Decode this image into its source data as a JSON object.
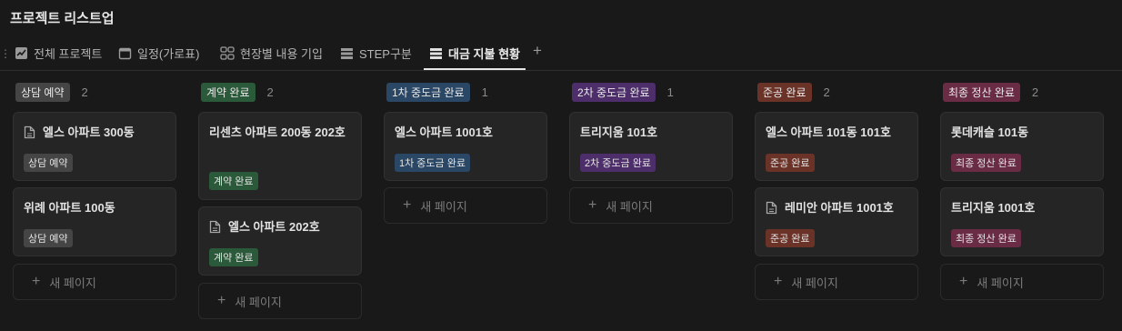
{
  "page_title": "프로젝트 리스트업",
  "tabs": [
    {
      "label": "전체 프로젝트",
      "icon": "trend-chart-icon"
    },
    {
      "label": "일정(가로표)",
      "icon": "calendar-icon"
    },
    {
      "label": "현장별 내용 기입",
      "icon": "gallery-grid-icon"
    },
    {
      "label": "STEP구분",
      "icon": "table-icon"
    },
    {
      "label": "대금 지불 현황",
      "icon": "board-icon",
      "active": true
    }
  ],
  "add_tab": "+",
  "new_page_label": "새 페이지",
  "columns": [
    {
      "label": "상담 예약",
      "count": "2",
      "color": "#454545",
      "cards": [
        {
          "title": "엘스 아파트 300동",
          "has_doc_icon": true,
          "badge": "상담 예약"
        },
        {
          "title": "위례 아파트 100동",
          "has_doc_icon": false,
          "badge": "상담 예약"
        }
      ]
    },
    {
      "label": "계약 완료",
      "count": "2",
      "color": "#2b5a3a",
      "cards": [
        {
          "title": "리센츠 아파트 200동 202호",
          "has_doc_icon": false,
          "badge": "계약 완료"
        },
        {
          "title": "엘스 아파트 202호",
          "has_doc_icon": true,
          "badge": "계약 완료"
        }
      ]
    },
    {
      "label": "1차 중도금 완료",
      "count": "1",
      "color": "#2a4766",
      "cards": [
        {
          "title": "엘스 아파트 1001호",
          "has_doc_icon": false,
          "badge": "1차 중도금 완료"
        }
      ]
    },
    {
      "label": "2차 중도금 완료",
      "count": "1",
      "color": "#4d2e6b",
      "cards": [
        {
          "title": "트리지움 101호",
          "has_doc_icon": false,
          "badge": "2차 중도금 완료"
        }
      ]
    },
    {
      "label": "준공 완료",
      "count": "2",
      "color": "#6b3328",
      "cards": [
        {
          "title": "엘스 아파트 101동 101호",
          "has_doc_icon": false,
          "badge": "준공 완료"
        },
        {
          "title": "레미안 아파트 1001호",
          "has_doc_icon": true,
          "badge": "준공 완료"
        }
      ]
    },
    {
      "label": "최종 정산 완료",
      "count": "2",
      "color": "#6a2c45",
      "cards": [
        {
          "title": "롯데캐슬 101동",
          "has_doc_icon": false,
          "badge": "최종 정산 완료"
        },
        {
          "title": "트리지움 1001호",
          "has_doc_icon": false,
          "badge": "최종 정산 완료"
        }
      ]
    }
  ]
}
